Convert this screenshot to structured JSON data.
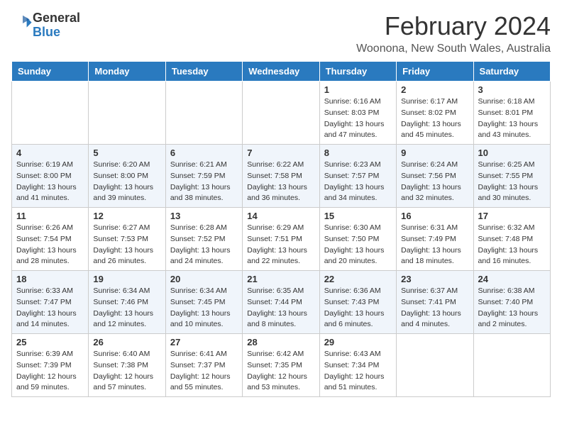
{
  "logo": {
    "text_general": "General",
    "text_blue": "Blue"
  },
  "title": "February 2024",
  "subtitle": "Woonona, New South Wales, Australia",
  "weekdays": [
    "Sunday",
    "Monday",
    "Tuesday",
    "Wednesday",
    "Thursday",
    "Friday",
    "Saturday"
  ],
  "weeks": [
    [
      {
        "day": "",
        "info": ""
      },
      {
        "day": "",
        "info": ""
      },
      {
        "day": "",
        "info": ""
      },
      {
        "day": "",
        "info": ""
      },
      {
        "day": "1",
        "info": "Sunrise: 6:16 AM\nSunset: 8:03 PM\nDaylight: 13 hours and 47 minutes."
      },
      {
        "day": "2",
        "info": "Sunrise: 6:17 AM\nSunset: 8:02 PM\nDaylight: 13 hours and 45 minutes."
      },
      {
        "day": "3",
        "info": "Sunrise: 6:18 AM\nSunset: 8:01 PM\nDaylight: 13 hours and 43 minutes."
      }
    ],
    [
      {
        "day": "4",
        "info": "Sunrise: 6:19 AM\nSunset: 8:00 PM\nDaylight: 13 hours and 41 minutes."
      },
      {
        "day": "5",
        "info": "Sunrise: 6:20 AM\nSunset: 8:00 PM\nDaylight: 13 hours and 39 minutes."
      },
      {
        "day": "6",
        "info": "Sunrise: 6:21 AM\nSunset: 7:59 PM\nDaylight: 13 hours and 38 minutes."
      },
      {
        "day": "7",
        "info": "Sunrise: 6:22 AM\nSunset: 7:58 PM\nDaylight: 13 hours and 36 minutes."
      },
      {
        "day": "8",
        "info": "Sunrise: 6:23 AM\nSunset: 7:57 PM\nDaylight: 13 hours and 34 minutes."
      },
      {
        "day": "9",
        "info": "Sunrise: 6:24 AM\nSunset: 7:56 PM\nDaylight: 13 hours and 32 minutes."
      },
      {
        "day": "10",
        "info": "Sunrise: 6:25 AM\nSunset: 7:55 PM\nDaylight: 13 hours and 30 minutes."
      }
    ],
    [
      {
        "day": "11",
        "info": "Sunrise: 6:26 AM\nSunset: 7:54 PM\nDaylight: 13 hours and 28 minutes."
      },
      {
        "day": "12",
        "info": "Sunrise: 6:27 AM\nSunset: 7:53 PM\nDaylight: 13 hours and 26 minutes."
      },
      {
        "day": "13",
        "info": "Sunrise: 6:28 AM\nSunset: 7:52 PM\nDaylight: 13 hours and 24 minutes."
      },
      {
        "day": "14",
        "info": "Sunrise: 6:29 AM\nSunset: 7:51 PM\nDaylight: 13 hours and 22 minutes."
      },
      {
        "day": "15",
        "info": "Sunrise: 6:30 AM\nSunset: 7:50 PM\nDaylight: 13 hours and 20 minutes."
      },
      {
        "day": "16",
        "info": "Sunrise: 6:31 AM\nSunset: 7:49 PM\nDaylight: 13 hours and 18 minutes."
      },
      {
        "day": "17",
        "info": "Sunrise: 6:32 AM\nSunset: 7:48 PM\nDaylight: 13 hours and 16 minutes."
      }
    ],
    [
      {
        "day": "18",
        "info": "Sunrise: 6:33 AM\nSunset: 7:47 PM\nDaylight: 13 hours and 14 minutes."
      },
      {
        "day": "19",
        "info": "Sunrise: 6:34 AM\nSunset: 7:46 PM\nDaylight: 13 hours and 12 minutes."
      },
      {
        "day": "20",
        "info": "Sunrise: 6:34 AM\nSunset: 7:45 PM\nDaylight: 13 hours and 10 minutes."
      },
      {
        "day": "21",
        "info": "Sunrise: 6:35 AM\nSunset: 7:44 PM\nDaylight: 13 hours and 8 minutes."
      },
      {
        "day": "22",
        "info": "Sunrise: 6:36 AM\nSunset: 7:43 PM\nDaylight: 13 hours and 6 minutes."
      },
      {
        "day": "23",
        "info": "Sunrise: 6:37 AM\nSunset: 7:41 PM\nDaylight: 13 hours and 4 minutes."
      },
      {
        "day": "24",
        "info": "Sunrise: 6:38 AM\nSunset: 7:40 PM\nDaylight: 13 hours and 2 minutes."
      }
    ],
    [
      {
        "day": "25",
        "info": "Sunrise: 6:39 AM\nSunset: 7:39 PM\nDaylight: 12 hours and 59 minutes."
      },
      {
        "day": "26",
        "info": "Sunrise: 6:40 AM\nSunset: 7:38 PM\nDaylight: 12 hours and 57 minutes."
      },
      {
        "day": "27",
        "info": "Sunrise: 6:41 AM\nSunset: 7:37 PM\nDaylight: 12 hours and 55 minutes."
      },
      {
        "day": "28",
        "info": "Sunrise: 6:42 AM\nSunset: 7:35 PM\nDaylight: 12 hours and 53 minutes."
      },
      {
        "day": "29",
        "info": "Sunrise: 6:43 AM\nSunset: 7:34 PM\nDaylight: 12 hours and 51 minutes."
      },
      {
        "day": "",
        "info": ""
      },
      {
        "day": "",
        "info": ""
      }
    ]
  ]
}
